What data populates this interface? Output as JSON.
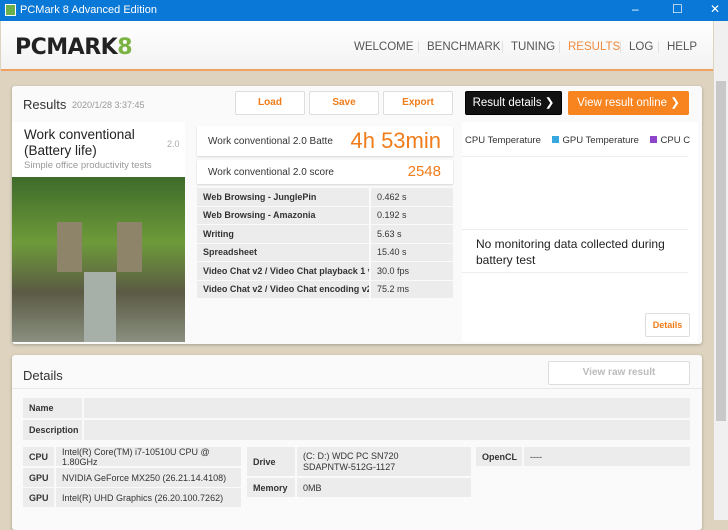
{
  "window": {
    "title": "PCMark 8 Advanced Edition",
    "minimize": "–",
    "maximize": "☐",
    "close": "✕"
  },
  "logo": {
    "text": "PCMARK",
    "eight": "8"
  },
  "nav": [
    "WELCOME",
    "BENCHMARK",
    "TUNING",
    "RESULTS",
    "LOG",
    "HELP"
  ],
  "results": {
    "title": "Results",
    "timestamp": "2020/1/28 3:37:45",
    "load": "Load",
    "save": "Save",
    "export": "Export",
    "result_details": "Result details ❯",
    "view_online": "View result online ❯"
  },
  "test": {
    "name": "Work conventional (Battery life)",
    "version": "2.0",
    "subtitle": "Simple office productivity tests"
  },
  "battery": {
    "label": "Work conventional 2.0 Batte",
    "value": "4h 53min"
  },
  "score": {
    "label": "Work conventional 2.0 score",
    "value": "2548"
  },
  "subtests": [
    {
      "name": "Web Browsing - JunglePin",
      "value": "0.462 s"
    },
    {
      "name": "Web Browsing - Amazonia",
      "value": "0.192 s"
    },
    {
      "name": "Writing",
      "value": "5.63 s"
    },
    {
      "name": "Spreadsheet",
      "value": "15.40 s"
    },
    {
      "name": "Video Chat v2 / Video Chat playback 1 v",
      "value": "30.0 fps"
    },
    {
      "name": "Video Chat v2 / Video Chat encoding v2",
      "value": "75.2 ms"
    }
  ],
  "monitoring": {
    "legend": [
      {
        "label": "CPU Temperature",
        "color": "#f07c1a"
      },
      {
        "label": "GPU Temperature",
        "color": "#35a8e0"
      },
      {
        "label": "CPU Cl",
        "color": "#8e44c8"
      }
    ],
    "message": "No monitoring data collected during battery test",
    "details": "Details"
  },
  "details": {
    "title": "Details",
    "view_raw": "View raw result",
    "name_label": "Name",
    "name": "",
    "description_label": "Description",
    "description": "",
    "cpu_label": "CPU",
    "cpu": "Intel(R) Core(TM) i7-10510U CPU @ 1.80GHz",
    "gpu1_label": "GPU",
    "gpu1": "NVIDIA GeForce MX250 (26.21.14.4108)",
    "gpu2_label": "GPU",
    "gpu2": "Intel(R) UHD Graphics (26.20.100.7262)",
    "drive_label": "Drive",
    "drive1": "(C: D:) WDC PC SN720",
    "drive2": "SDAPNTW-512G-1127",
    "memory_label": "Memory",
    "memory": "0MB",
    "opencl_label": "OpenCL",
    "opencl": "----"
  }
}
